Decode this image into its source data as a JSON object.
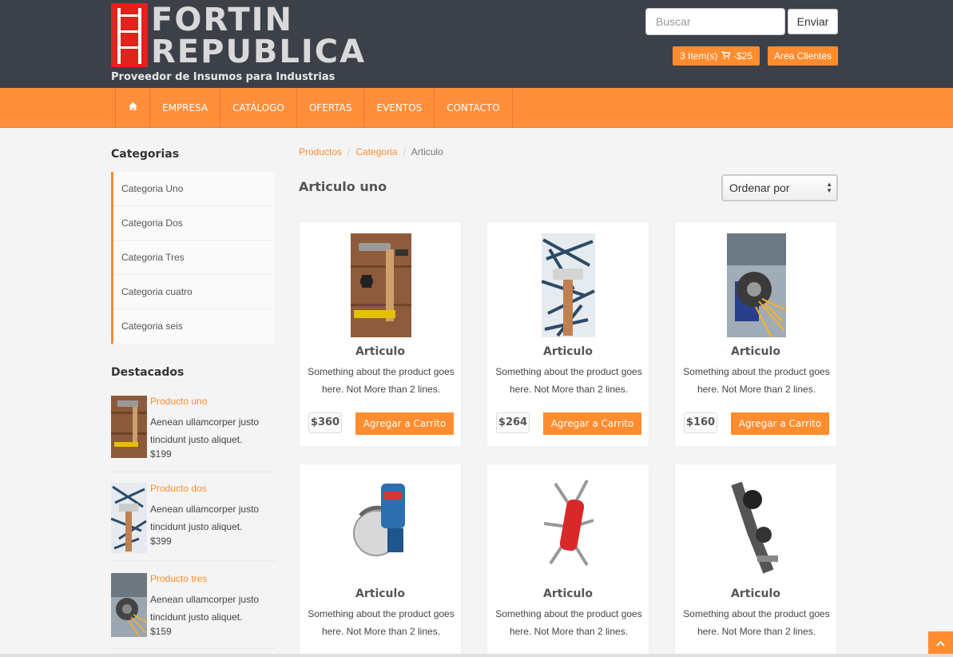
{
  "brand": {
    "line1": "FORTIN",
    "line2": "REPUBLICA",
    "tagline": "Proveedor de Insumos para Industrias",
    "color_red": "#e0231b"
  },
  "header": {
    "search_placeholder": "Buscar",
    "search_button": "Enviar",
    "cart_label": "3 Item(s) ",
    "cart_icon": "cart-icon",
    "cart_amount": " -$25",
    "clientes_label": "Area Clientes",
    "accent_color": "#ff8c2e",
    "bg_color": "#3c4049"
  },
  "nav": {
    "home_icon": "home-icon",
    "items": [
      "EMPRESA",
      "CATÁLOGO",
      "OFERTAS",
      "EVENTOS",
      "CONTACTO"
    ]
  },
  "sidebar": {
    "categories_title": "Categorias",
    "categories": [
      "Categoria Uno",
      "Categoria Dos",
      "Categoria Tres",
      "Categoria cuatro",
      "Categoria seis"
    ],
    "featured_title": "Destacados",
    "featured": [
      {
        "name": "Producto uno",
        "desc": "Aenean ullamcorper justo tincidunt justo aliquet.",
        "price": "$199"
      },
      {
        "name": "Producto dos",
        "desc": "Aenean ullamcorper justo tincidunt justo aliquet.",
        "price": "$399"
      },
      {
        "name": "Producto tres",
        "desc": "Aenean ullamcorper justo tincidunt justo aliquet.",
        "price": "$159"
      }
    ]
  },
  "main": {
    "breadcrumb": [
      "Productos",
      "Categoria",
      "Articulo"
    ],
    "title": "Articulo uno",
    "sort_label": "Ordenar por",
    "add_button": "Agregar a Carrito",
    "products": [
      {
        "title": "Articulo",
        "desc": "Something about the product goes here. Not More than 2 lines.",
        "price": "$360"
      },
      {
        "title": "Articulo",
        "desc": "Something about the product goes here. Not More than 2 lines.",
        "price": "$264"
      },
      {
        "title": "Articulo",
        "desc": "Something about the product goes here. Not More than 2 lines.",
        "price": "$160"
      },
      {
        "title": "Articulo",
        "desc": "Something about the product goes here. Not More than 2 lines."
      },
      {
        "title": "Articulo",
        "desc": "Something about the product goes here. Not More than 2 lines."
      },
      {
        "title": "Articulo",
        "desc": "Something about the product goes here. Not More than 2 lines."
      }
    ]
  }
}
